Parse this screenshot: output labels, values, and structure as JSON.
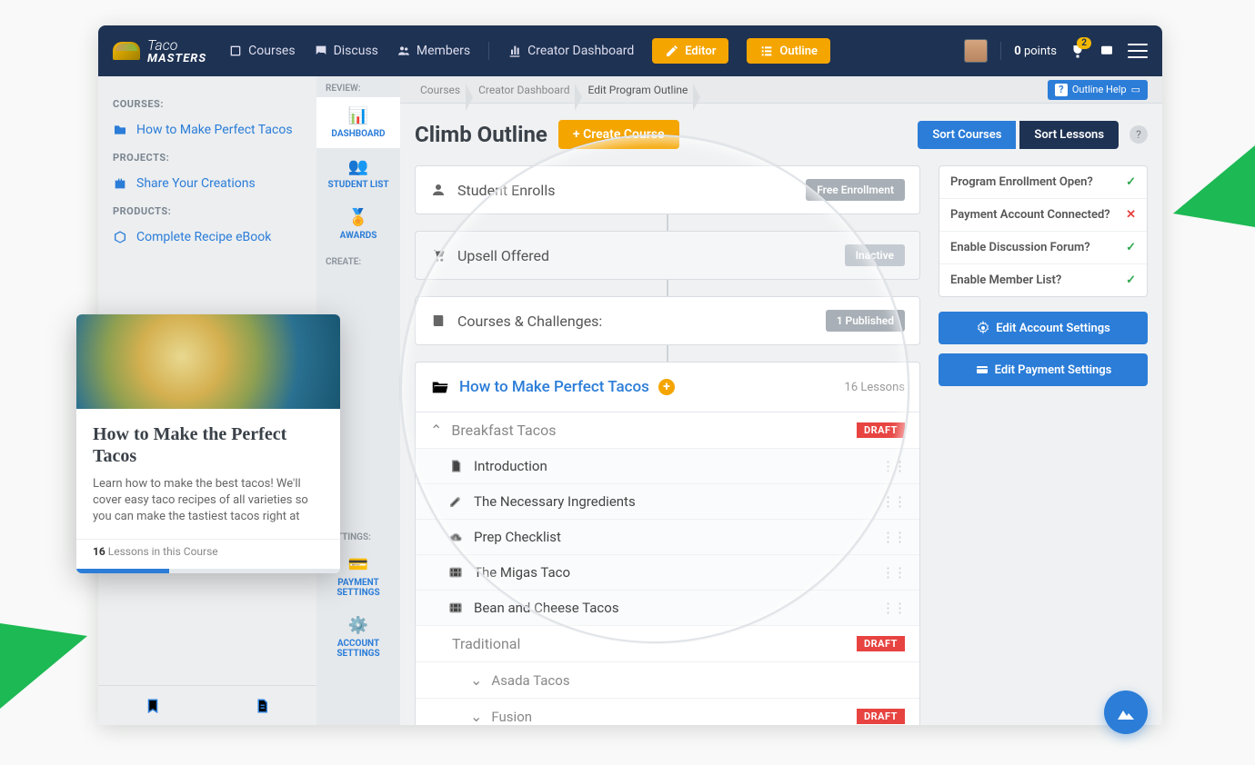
{
  "brand": {
    "line1": "Taco",
    "line2": "MASTERS"
  },
  "nav": {
    "courses": "Courses",
    "discuss": "Discuss",
    "members": "Members",
    "dashboard": "Creator Dashboard",
    "editor": "Editor",
    "outline": "Outline"
  },
  "user": {
    "points_value": "0",
    "points_label": "points",
    "notif": "2"
  },
  "sidebar": {
    "courses_label": "COURSES:",
    "courses_item": "How to Make Perfect Tacos",
    "projects_label": "PROJECTS:",
    "projects_item": "Share Your Creations",
    "products_label": "PRODUCTS:",
    "products_item": "Complete Recipe eBook"
  },
  "sidetabs": {
    "review": "REVIEW:",
    "create": "CREATE:",
    "settings": "SETTINGS:",
    "dashboard": "DASHBOARD",
    "students": "STUDENT LIST",
    "awards": "AWARDS",
    "payment": "PAYMENT SETTINGS",
    "account": "ACCOUNT SETTINGS"
  },
  "crumbs": {
    "a": "Courses",
    "b": "Creator Dashboard",
    "c": "Edit Program Outline",
    "help": "Outline Help"
  },
  "head": {
    "title": "Climb Outline",
    "create": "+ Create Course",
    "sortc": "Sort Courses",
    "sortl": "Sort Lessons"
  },
  "stage1": {
    "title": "Student Enrolls",
    "pill": "Free Enrollment"
  },
  "stage2": {
    "title": "Upsell Offered",
    "pill": "Inactive"
  },
  "stage3": {
    "title": "Courses & Challenges:",
    "pill": "1 Published"
  },
  "course": {
    "title": "How to Make Perfect Tacos",
    "count": "16 Lessons"
  },
  "sec1": {
    "name": "Breakfast Tacos",
    "badge": "DRAFT"
  },
  "lessons": {
    "l1": "Introduction",
    "l2": "The Necessary Ingredients",
    "l3": "Prep Checklist",
    "l4": "The Migas Taco",
    "l5": "Bean and Cheese Tacos"
  },
  "sec2": {
    "name": "Traditional",
    "badge": "DRAFT"
  },
  "sec2sub": {
    "name": "Asada Tacos"
  },
  "sec3": {
    "name": "Fusion",
    "badge": "DRAFT"
  },
  "status": {
    "s1": "Program Enrollment Open?",
    "s2": "Payment Account Connected?",
    "s3": "Enable Discussion Forum?",
    "s4": "Enable Member List?"
  },
  "actions": {
    "account": "Edit Account Settings",
    "payment": "Edit Payment Settings"
  },
  "card": {
    "title": "How to Make the Perfect Tacos",
    "desc": "Learn how to make the best tacos! We'll cover easy taco recipes of all varieties so you can make the tastiest tacos right at",
    "count": "16",
    "label": "Lessons in this Course"
  }
}
